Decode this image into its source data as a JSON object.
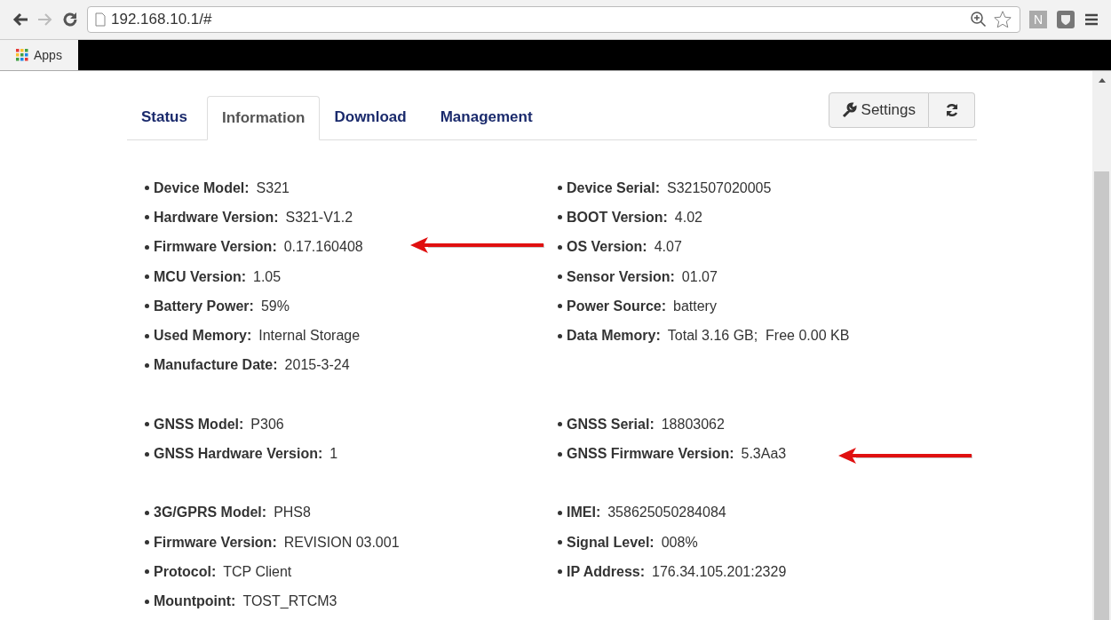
{
  "browser": {
    "url": "192.168.10.1/#",
    "extension_letter": "N",
    "bookmarks": [
      {
        "label": "Apps"
      }
    ]
  },
  "tabs": [
    {
      "label": "Status",
      "selected": false
    },
    {
      "label": "Information",
      "selected": true
    },
    {
      "label": "Download",
      "selected": false
    },
    {
      "label": "Management",
      "selected": false
    }
  ],
  "settings_button": {
    "label": "Settings"
  },
  "sections": [
    {
      "left": [
        {
          "label": "Device Model:",
          "value": "S321"
        },
        {
          "label": "Hardware Version:",
          "value": "S321-V1.2"
        },
        {
          "label": "Firmware Version:",
          "value": "0.17.160408"
        },
        {
          "label": "MCU Version:",
          "value": "1.05"
        },
        {
          "label": "Battery Power:",
          "value": "59%"
        },
        {
          "label": "Used Memory:",
          "value": "Internal Storage"
        },
        {
          "label": "Manufacture Date:",
          "value": "2015-3-24"
        }
      ],
      "right": [
        {
          "label": "Device Serial:",
          "value": "S321507020005"
        },
        {
          "label": "BOOT Version:",
          "value": "4.02"
        },
        {
          "label": "OS Version:",
          "value": "4.07"
        },
        {
          "label": "Sensor Version:",
          "value": "01.07"
        },
        {
          "label": "Power Source:",
          "value": "battery"
        },
        {
          "label": "Data Memory:",
          "value": "Total 3.16 GB;  Free 0.00 KB"
        }
      ]
    },
    {
      "left": [
        {
          "label": "GNSS Model:",
          "value": "P306"
        },
        {
          "label": "GNSS Hardware Version:",
          "value": "1"
        }
      ],
      "right": [
        {
          "label": "GNSS Serial:",
          "value": "18803062"
        },
        {
          "label": "GNSS Firmware Version:",
          "value": "5.3Aa3"
        }
      ]
    },
    {
      "left": [
        {
          "label": "3G/GPRS Model:",
          "value": "PHS8"
        },
        {
          "label": "Firmware Version:",
          "value": "REVISION 03.001"
        },
        {
          "label": "Protocol:",
          "value": "TCP Client"
        },
        {
          "label": "Mountpoint:",
          "value": "TOST_RTCM3"
        }
      ],
      "right": [
        {
          "label": "IMEI:",
          "value": "358625050284084"
        },
        {
          "label": "Signal Level:",
          "value": "008%"
        },
        {
          "label": "IP Address:",
          "value": "176.34.105.201:2329"
        }
      ]
    }
  ]
}
